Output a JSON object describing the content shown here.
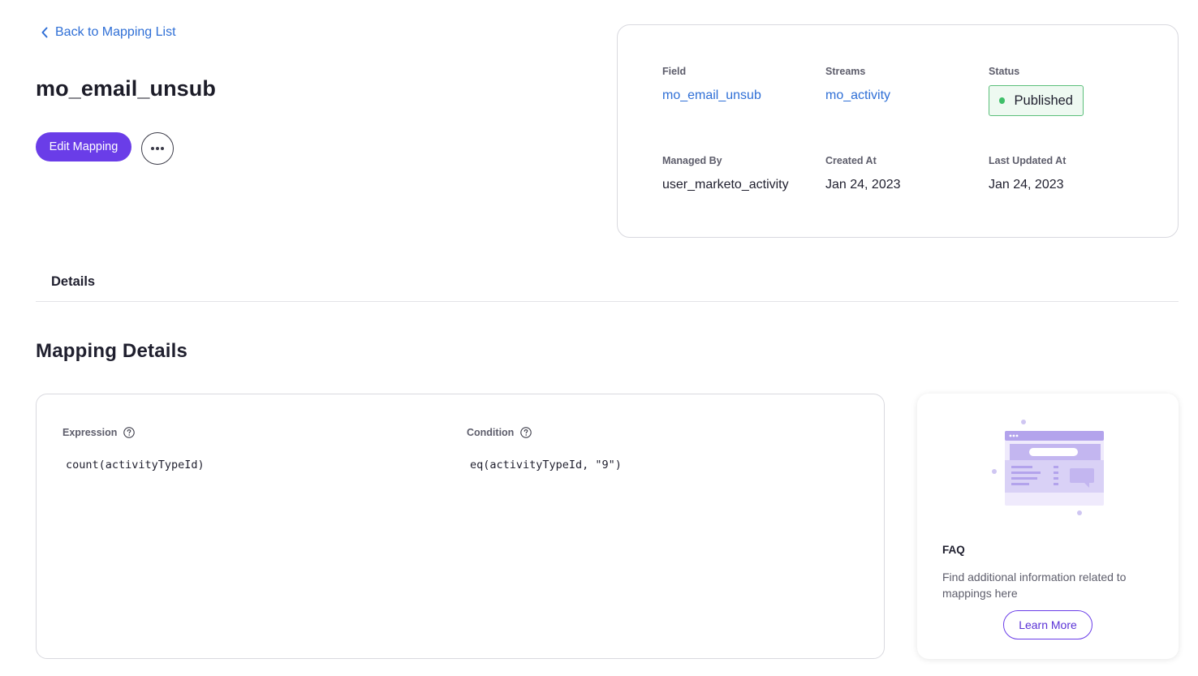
{
  "nav": {
    "back_label": "Back to Mapping List"
  },
  "header": {
    "title": "mo_email_unsub",
    "edit_label": "Edit Mapping"
  },
  "info": {
    "field_label": "Field",
    "field_value": "mo_email_unsub",
    "streams_label": "Streams",
    "streams_value": "mo_activity",
    "status_label": "Status",
    "status_value": "Published",
    "managed_label": "Managed By",
    "managed_value": "user_marketo_activity",
    "created_label": "Created At",
    "created_value": "Jan 24, 2023",
    "updated_label": "Last Updated At",
    "updated_value": "Jan 24, 2023"
  },
  "tabs": [
    {
      "label": "Details"
    }
  ],
  "section": {
    "title": "Mapping Details"
  },
  "mapping": {
    "expression_label": "Expression",
    "expression_value": "count(activityTypeId)",
    "condition_label": "Condition",
    "condition_value": "eq(activityTypeId, \"9\")"
  },
  "faq": {
    "title": "FAQ",
    "text": "Find additional information related to mappings here",
    "button": "Learn More"
  },
  "colors": {
    "accent": "#6a3de8",
    "link": "#2f6fd6",
    "status_published": "#3fbf69"
  },
  "icons": {
    "back": "chevron-left-icon",
    "more": "more-horizontal-icon",
    "help": "help-circle-icon",
    "illustration": "faq-illustration"
  }
}
